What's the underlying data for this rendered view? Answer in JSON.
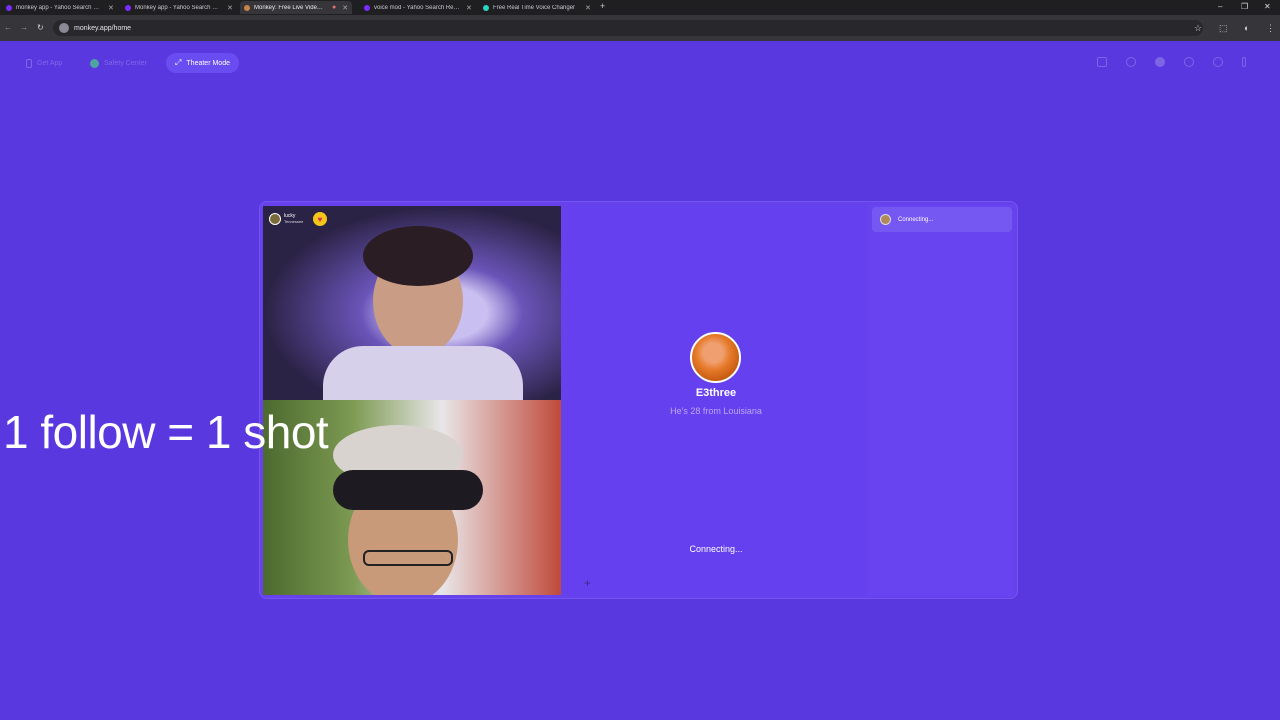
{
  "browser": {
    "tabs": [
      {
        "title": "monkey app - Yahoo Search Results",
        "icon": "yahoo-icon",
        "color": "#7b2cff"
      },
      {
        "title": "Monkey app - Yahoo Search Results",
        "icon": "yahoo-icon",
        "color": "#7b2cff"
      },
      {
        "title": "Monkey: Free Live Video Chat",
        "icon": "monkey-icon",
        "color": "#c9834a",
        "active": true
      },
      {
        "title": "voice mod - Yahoo Search Results",
        "icon": "yahoo-icon",
        "color": "#7b2cff"
      },
      {
        "title": "Free Real Time Voice Changer",
        "icon": "voicemod-icon",
        "color": "#2ad4c0"
      }
    ],
    "url": "monkey.app/home"
  },
  "header": {
    "get_app": "Get App",
    "safety_center": "Safety Center",
    "theater_mode": "Theater Mode"
  },
  "overlay_text": "1 follow = 1 shot",
  "video_top": {
    "username": "lucky",
    "location": "Tennessee"
  },
  "match": {
    "name": "E3three",
    "info": "He's 28 from Louisiana",
    "status": "Connecting..."
  },
  "side_panel": {
    "status": "Connecting..."
  },
  "colors": {
    "background": "#5a38e0",
    "panel": "#6641ec",
    "accent_button": "#6a4df0"
  }
}
